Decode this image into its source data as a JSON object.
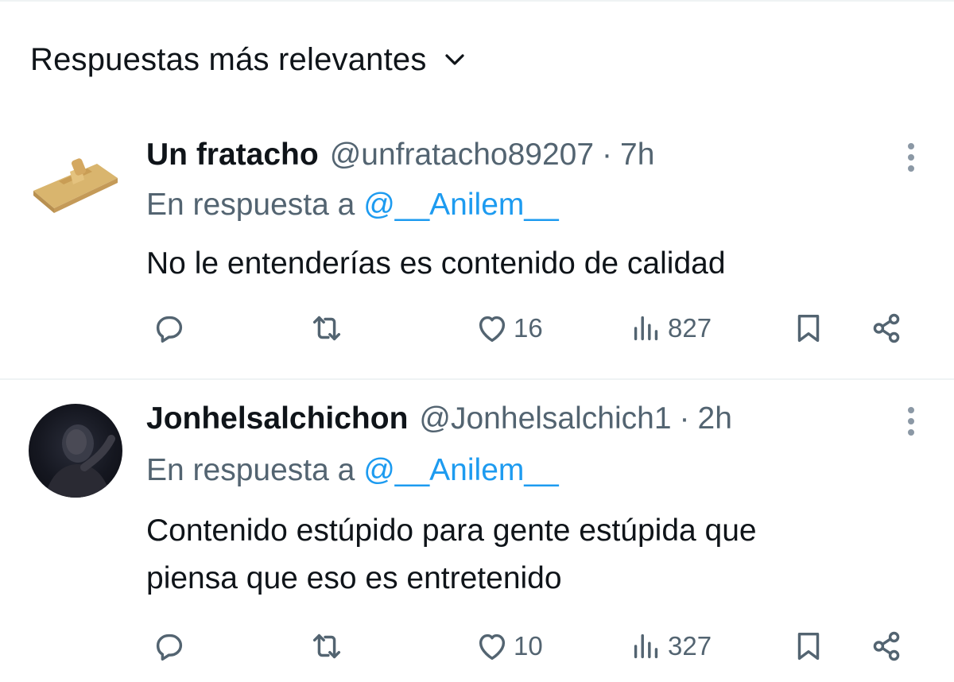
{
  "header": {
    "sort_label": "Respuestas más relevantes"
  },
  "replies": [
    {
      "name": "Un fratacho",
      "handle": "@unfratacho89207",
      "time": "7h",
      "in_reply_prefix": "En respuesta a",
      "in_reply_mention": "@__Anilem__",
      "text_lines": [
        "No le entenderías es contenido de calidad"
      ],
      "likes": "16",
      "views": "827"
    },
    {
      "name": "Jonhelsalchichon",
      "handle": "@Jonhelsalchich1",
      "time": "2h",
      "in_reply_prefix": "En respuesta a",
      "in_reply_mention": "@__Anilem__",
      "text_lines": [
        "Contenido estúpido para gente estúpida que",
        "piensa que eso es entretenido"
      ],
      "likes": "10",
      "views": "327"
    }
  ],
  "separator": "·",
  "colors": {
    "text": "#0f1419",
    "secondary": "#536471",
    "link": "#1d9bf0",
    "divider": "#eff3f4"
  },
  "icons": [
    "chevron-down-icon",
    "more-dots-icon",
    "reply-icon",
    "retweet-icon",
    "like-icon",
    "views-icon",
    "bookmark-icon",
    "share-icon"
  ]
}
